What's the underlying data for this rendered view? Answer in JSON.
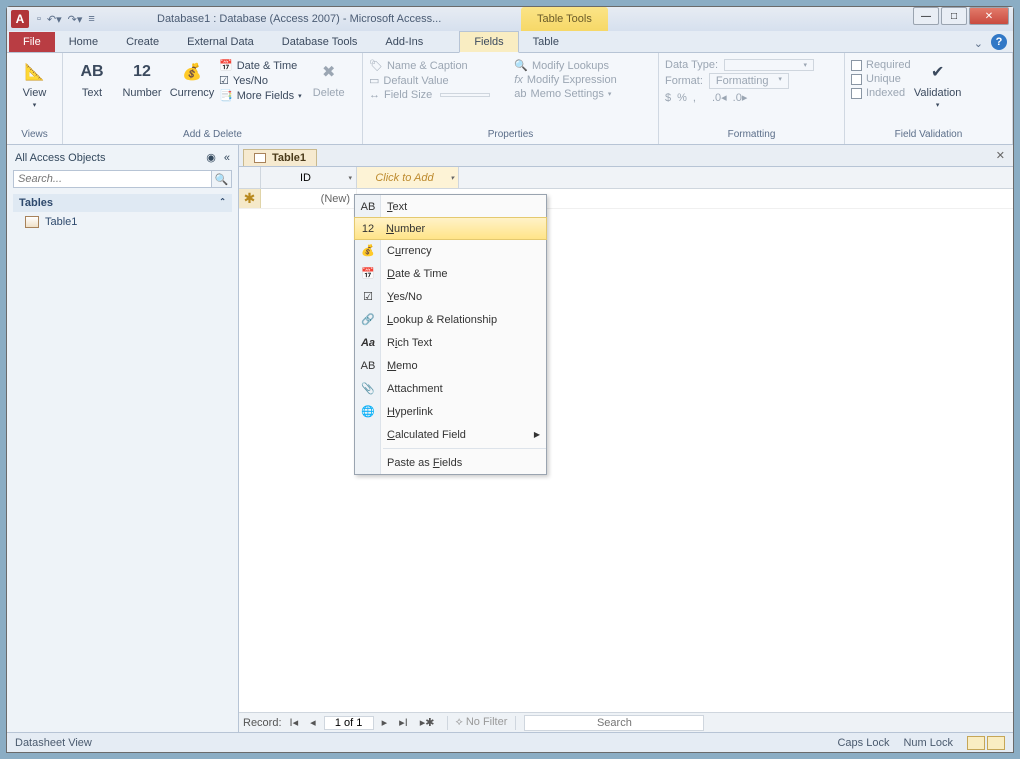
{
  "title": "Database1 : Database (Access 2007)  -  Microsoft Access...",
  "context_tool": "Table Tools",
  "tabs": {
    "file": "File",
    "home": "Home",
    "create": "Create",
    "externaldata": "External Data",
    "dbtools": "Database Tools",
    "addins": "Add-Ins",
    "fields": "Fields",
    "table": "Table"
  },
  "ribbon": {
    "views": {
      "label": "Views",
      "view": "View"
    },
    "addtypes": {
      "label": "Add & Delete",
      "text": "Text",
      "number": "Number",
      "currency": "Currency",
      "datetime": "Date & Time",
      "yesno": "Yes/No",
      "morefields": "More Fields",
      "delete": "Delete"
    },
    "properties": {
      "label": "Properties",
      "namecaption": "Name & Caption",
      "default": "Default Value",
      "fieldsize": "Field Size",
      "modlookups": "Modify Lookups",
      "modexpr": "Modify Expression",
      "memoset": "Memo Settings"
    },
    "formatting": {
      "label": "Formatting",
      "datatype": "Data Type:",
      "format": "Format:",
      "fmtval": "Formatting"
    },
    "validation": {
      "label": "Field Validation",
      "required": "Required",
      "unique": "Unique",
      "indexed": "Indexed",
      "validation": "Validation"
    }
  },
  "nav": {
    "title": "All Access Objects",
    "search": "Search...",
    "section": "Tables",
    "item": "Table1"
  },
  "doc": {
    "tab": "Table1"
  },
  "cols": {
    "id": "ID",
    "add": "Click to Add"
  },
  "row": {
    "newval": "(New)"
  },
  "dropdown": {
    "text": "Text",
    "number": "Number",
    "currency": "Currency",
    "datetime": "Date & Time",
    "yesno": "Yes/No",
    "lookup": "Lookup & Relationship",
    "rich": "Rich Text",
    "memo": "Memo",
    "attach": "Attachment",
    "hyper": "Hyperlink",
    "calc": "Calculated Field",
    "paste": "Paste as Fields"
  },
  "recnav": {
    "label": "Record:",
    "pos": "1 of 1",
    "nofilter": "No Filter",
    "search": "Search"
  },
  "status": {
    "view": "Datasheet View",
    "caps": "Caps Lock",
    "num": "Num Lock"
  }
}
